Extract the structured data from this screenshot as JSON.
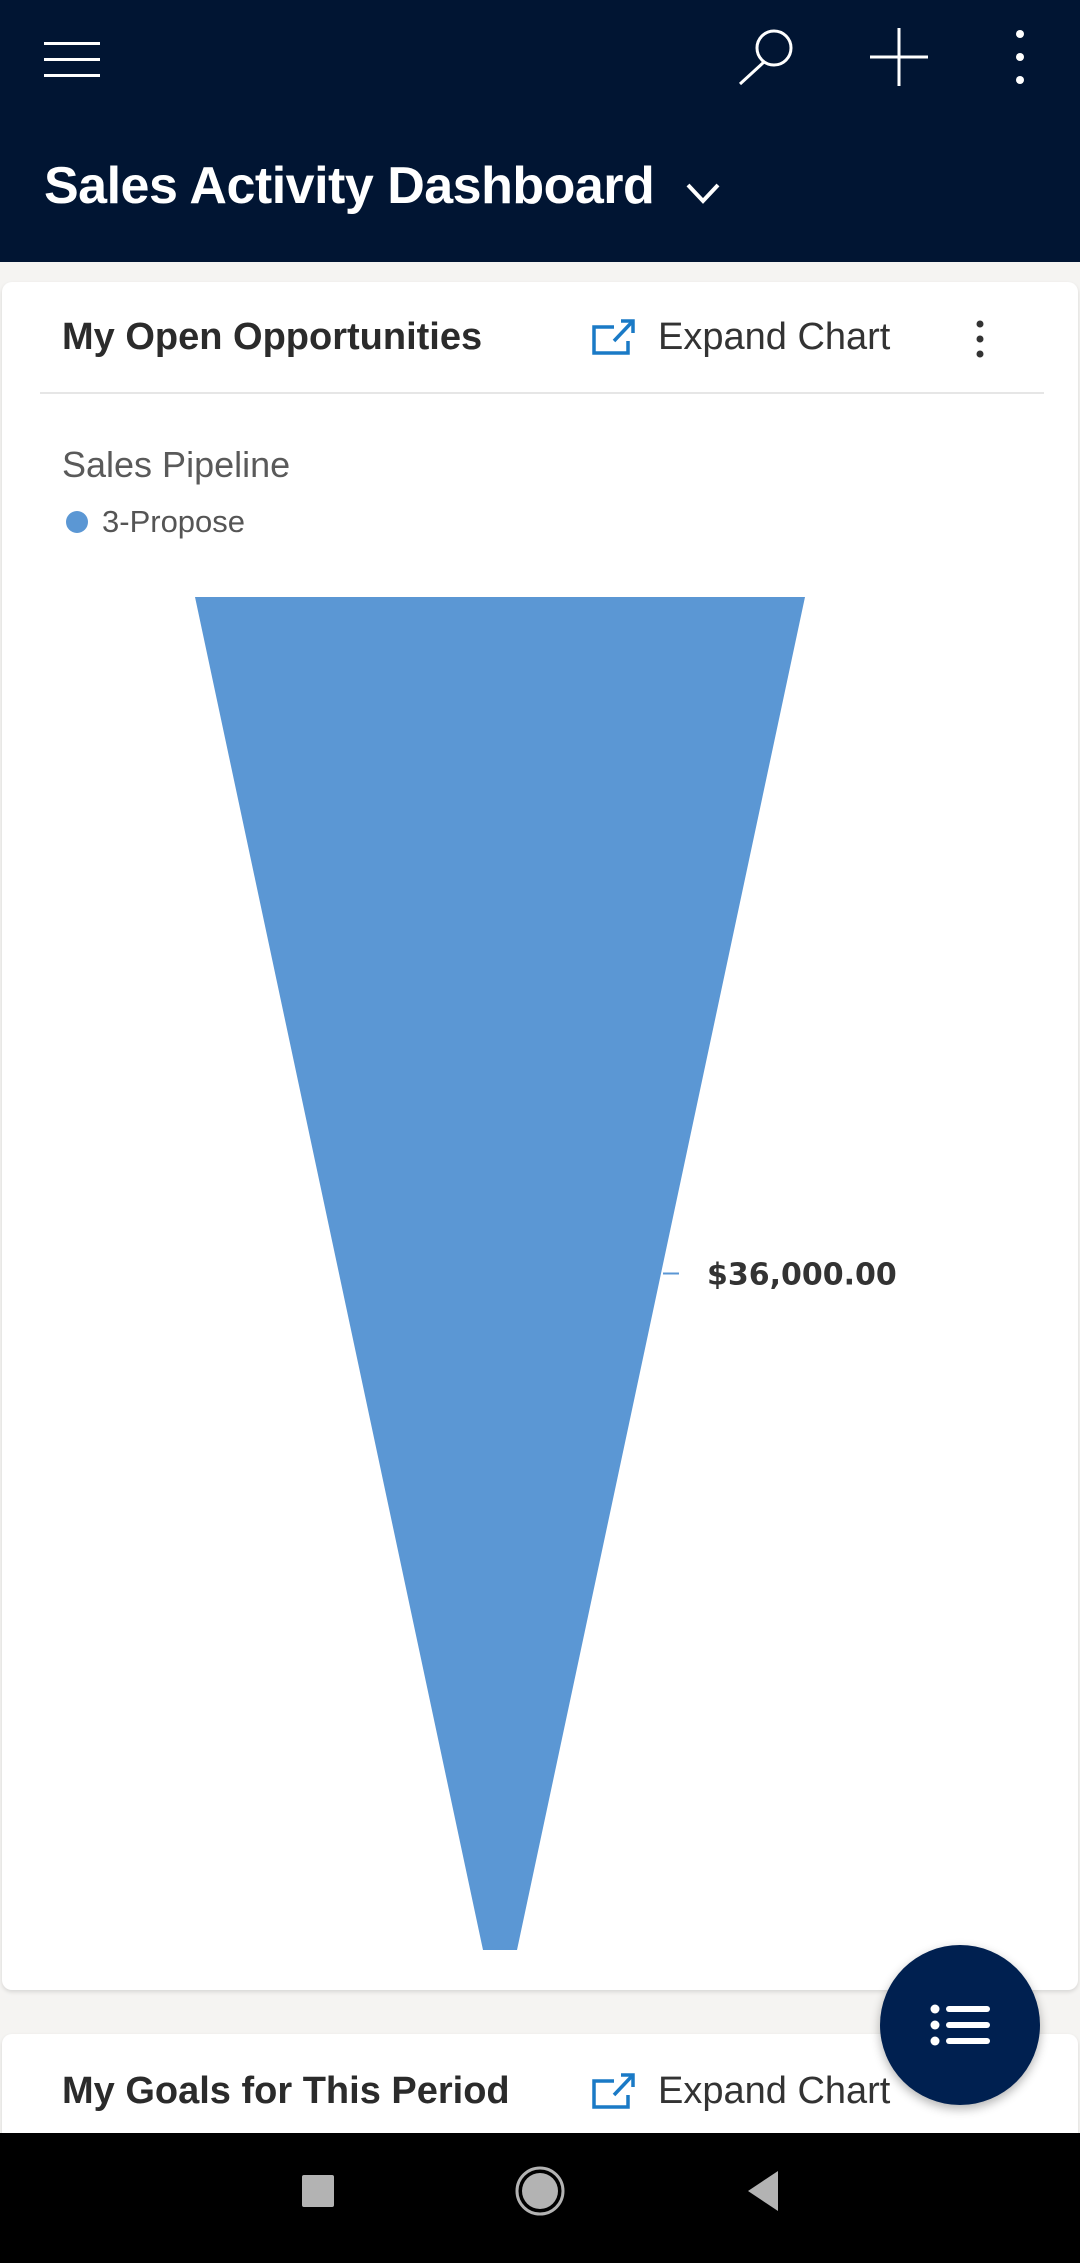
{
  "header": {
    "title": "Sales Activity Dashboard",
    "icons": [
      "menu-icon",
      "search-icon",
      "plus-icon",
      "more-vertical-icon",
      "chevron-down-icon"
    ]
  },
  "cards": [
    {
      "title": "My Open Opportunities",
      "expand_label": "Expand Chart",
      "expand_icon": "expand-icon",
      "more_icon": "more-vertical-icon"
    },
    {
      "title": "My Goals for This Period",
      "expand_label": "Expand Chart",
      "expand_icon": "expand-icon"
    }
  ],
  "colors": {
    "header_bg": "#011533",
    "funnel_fill": "#5b97d4",
    "accent": "#1a7ac6",
    "fab_bg": "#002050"
  },
  "chart_data": {
    "type": "funnel",
    "title": "Sales Pipeline",
    "legend": [
      {
        "name": "3-Propose",
        "color": "#5b97d4"
      }
    ],
    "legend_position": "top-left",
    "series": [
      {
        "name": "3-Propose",
        "stage": "3-Propose",
        "value": 36000,
        "label": "$36,000.00"
      }
    ]
  },
  "fab": {
    "icon": "list-icon"
  },
  "nav": {
    "icons": [
      "recents-icon",
      "home-icon",
      "back-icon"
    ]
  }
}
